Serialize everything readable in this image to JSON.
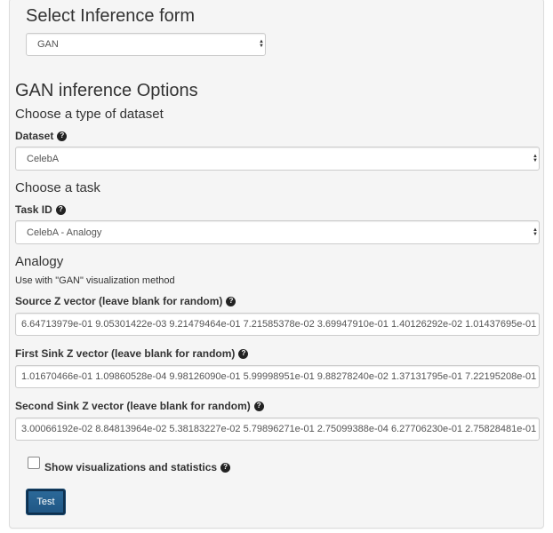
{
  "form_selector": {
    "title": "Select Inference form",
    "selected": "GAN"
  },
  "options": {
    "title": "GAN inference Options",
    "dataset_section": {
      "heading": "Choose a type of dataset",
      "label": "Dataset",
      "selected": "CelebA"
    },
    "task_section": {
      "heading": "Choose a task",
      "label": "Task ID",
      "selected": "CelebA - Analogy"
    },
    "analogy": {
      "heading": "Analogy",
      "help": "Use with \"GAN\" visualization method",
      "source_label": "Source Z vector (leave blank for random)",
      "source_value": "6.64713979e-01 9.05301422e-03 9.21479464e-01 7.21585378e-02 3.69947910e-01 1.40126292e-02 1.01437695e-01",
      "sink1_label": "First Sink Z vector (leave blank for random)",
      "sink1_value": "1.01670466e-01 1.09860528e-04 9.98126090e-01 5.99998951e-01 9.88278240e-02 1.37131795e-01 7.22195208e-01",
      "sink2_label": "Second Sink Z vector (leave blank for random)",
      "sink2_value": "3.00066192e-02 8.84813964e-02 5.38183227e-02 5.79896271e-01 2.75099388e-04 6.27706230e-01 2.75828481e-01"
    },
    "show_stats_label": "Show visualizations and statistics",
    "submit_label": "Test"
  },
  "icons": {
    "help": "question-circle-icon",
    "caret": "select-caret-icon"
  },
  "colors": {
    "panel_bg": "#f5f5f5",
    "button_bg": "#1f5583"
  }
}
